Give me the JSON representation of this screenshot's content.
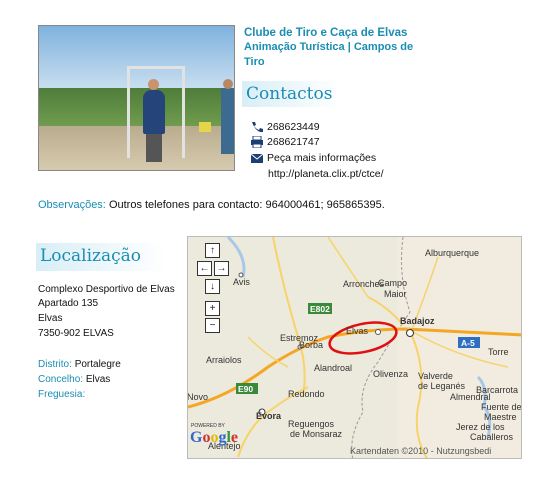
{
  "club": {
    "title": "Clube de Tiro e Caça de Elvas",
    "subtitle": "Animação Turística | Campos de Tiro"
  },
  "contactos": {
    "heading": "Contactos",
    "phone": "268623449",
    "fax": "268621747",
    "info_link": "Peça mais informações",
    "url": "http://planeta.clix.pt/ctce/"
  },
  "observacoes": {
    "label": "Observações:",
    "text": "Outros telefones para contacto: 964000461; 965865395."
  },
  "localizacao": {
    "heading": "Localização",
    "address": [
      "Complexo Desportivo de Elvas",
      "Apartado 135",
      "Elvas",
      "7350-902 ELVAS"
    ],
    "distrito_label": "Distrito:",
    "distrito": "Portalegre",
    "concelho_label": "Concelho:",
    "concelho": "Elvas",
    "freguesia_label": "Freguesia:"
  },
  "map": {
    "places": [
      "Alburquerque",
      "Avis",
      "Arronches",
      "Campo Maior",
      "Badajoz",
      "Estremoz",
      "Borba",
      "Elvas",
      "Arraiolos",
      "Alandroal",
      "Olivenza",
      "Valverde de Leganés",
      "Barcarrota",
      "Redondo",
      "Évora",
      "Reguengos de Monsaraz",
      "Jerez de los Caballeros",
      "Fuente del Maestre",
      "Alentejo",
      "Almendral",
      "Montemor-o-Novo",
      "Torre de Miguel Sesmero"
    ],
    "roads": [
      "E802",
      "A-5",
      "E90"
    ],
    "credits": "Kartendaten ©2010 - Nutzungsbedi",
    "powered": "POWERED BY",
    "logo": "Google",
    "controls": [
      "↑",
      "←",
      "→",
      "↓",
      "+",
      "−"
    ]
  },
  "colors": {
    "accent": "#1a8db3",
    "marker": "#e01010"
  }
}
